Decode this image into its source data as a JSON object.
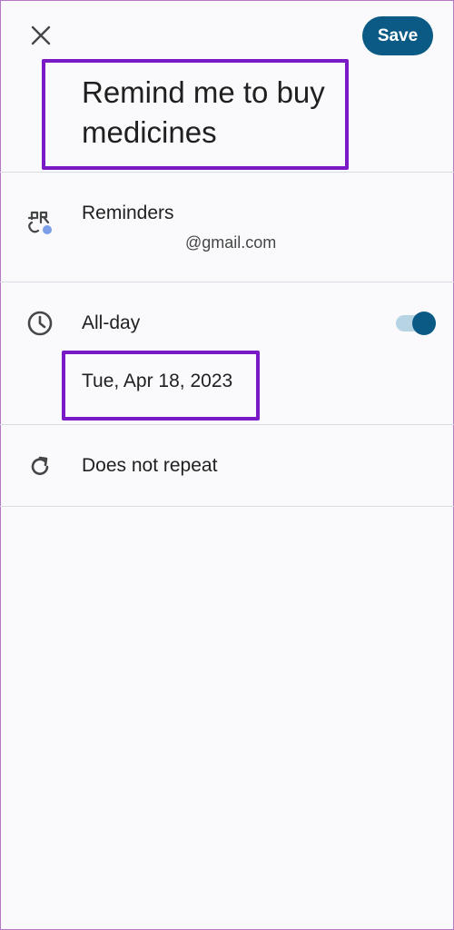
{
  "header": {
    "close_icon": "close-icon",
    "save_label": "Save"
  },
  "title": "Remind me to buy medicines",
  "account": {
    "icon": "reminders-icon",
    "label": "Reminders",
    "email": "@gmail.com"
  },
  "schedule": {
    "icon": "clock-icon",
    "allday_label": "All-day",
    "allday_on": true,
    "date": "Tue, Apr 18, 2023"
  },
  "repeat": {
    "icon": "repeat-icon",
    "label": "Does not repeat"
  },
  "colors": {
    "accent": "#0b5a85",
    "highlight": "#7a19c6",
    "background": "#fafafc"
  }
}
